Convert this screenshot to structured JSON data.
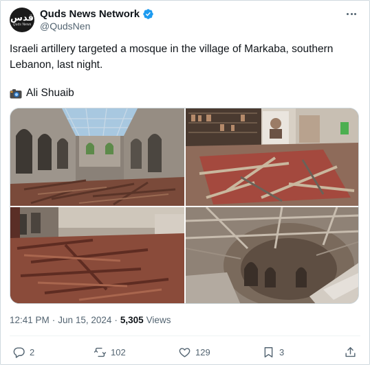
{
  "account": {
    "display_name": "Quds News Network",
    "handle": "@QudsNen",
    "avatar_mark": "قدس",
    "avatar_sub": "Quds News"
  },
  "tweet": {
    "text": "Israeli artillery targeted a mosque in the village of Markaba, southern Lebanon, last night.",
    "credit_icon": "camera-icon",
    "credit_name": "Ali Shuaib"
  },
  "media": {
    "photos": [
      {
        "name": "photo-mosque-interior-roof-collapsed"
      },
      {
        "name": "photo-mosque-library-debris"
      },
      {
        "name": "photo-mosque-hall-rubble"
      },
      {
        "name": "photo-mosque-dome-destroyed"
      }
    ]
  },
  "meta": {
    "time": "12:41 PM",
    "separator": "·",
    "date": "Jun 15, 2024",
    "views_count": "5,305",
    "views_label": "Views"
  },
  "actions": {
    "replies": "2",
    "retweets": "102",
    "likes": "129",
    "bookmarks": "3"
  },
  "colors": {
    "text_primary": "#0f1419",
    "text_secondary": "#536471",
    "verified": "#1d9bf0",
    "border": "#cfd9de"
  }
}
